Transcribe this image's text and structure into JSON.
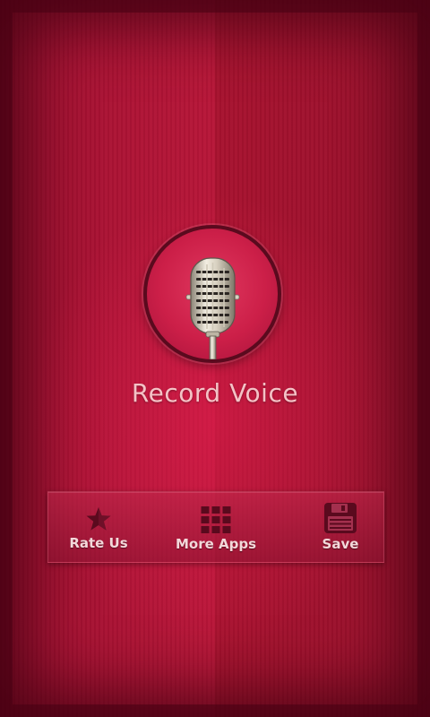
{
  "app": {
    "title": "Record Voice"
  },
  "toolbar": {
    "rate_label": "Rate Us",
    "more_apps_label": "More Apps",
    "save_label": "Save"
  },
  "icons": {
    "record": "microphone-icon",
    "rate": "star-icon",
    "more_apps": "grid-icon",
    "save": "floppy-disk-icon"
  },
  "colors": {
    "background": "#b81638",
    "title_text": "#f4c2c6",
    "icon_dark": "#5a0a1e",
    "label_text": "#f3d8da"
  }
}
